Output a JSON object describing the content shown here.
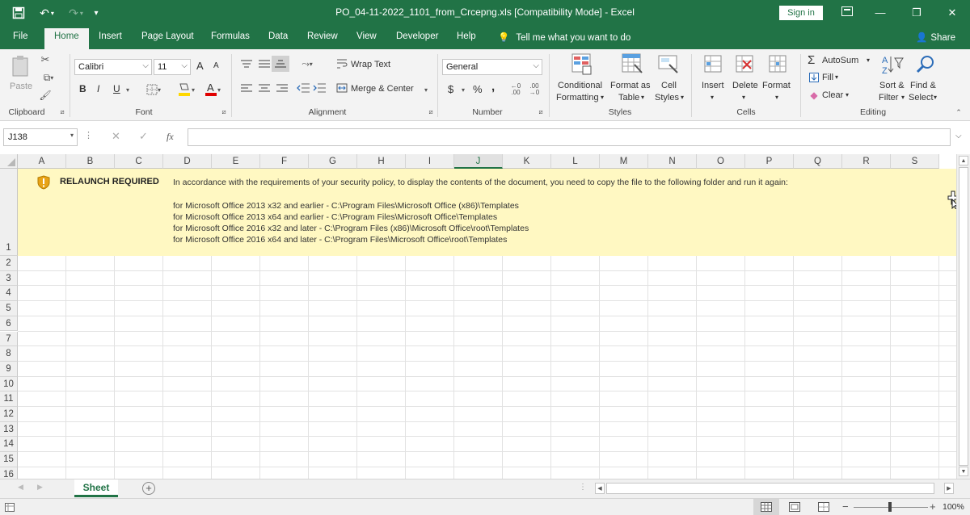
{
  "window": {
    "title": "PO_04-11-2022_1101_from_Crcepng.xls [Compatibility Mode] - Excel",
    "sign_in": "Sign in",
    "share": "Share",
    "tell_me": "Tell me what you want to do"
  },
  "tabs": [
    "File",
    "Home",
    "Insert",
    "Page Layout",
    "Formulas",
    "Data",
    "Review",
    "View",
    "Developer",
    "Help"
  ],
  "ribbon": {
    "clipboard": {
      "paste": "Paste",
      "label": "Clipboard"
    },
    "font": {
      "name": "Calibri",
      "size": "11",
      "label": "Font",
      "bold": "B",
      "italic": "I",
      "underline": "U",
      "grow": "A",
      "shrink": "A"
    },
    "alignment": {
      "wrap_text": "Wrap Text",
      "merge_center": "Merge & Center",
      "label": "Alignment"
    },
    "number": {
      "format": "General",
      "currency": "$",
      "percent": "%",
      "comma": ",",
      "label": "Number"
    },
    "styles": {
      "conditional_1": "Conditional",
      "conditional_2": "Formatting",
      "format_table_1": "Format as",
      "format_table_2": "Table",
      "cell_styles_1": "Cell",
      "cell_styles_2": "Styles",
      "label": "Styles"
    },
    "cells": {
      "insert": "Insert",
      "delete": "Delete",
      "format": "Format",
      "label": "Cells"
    },
    "editing": {
      "autosum": "AutoSum",
      "fill": "Fill",
      "clear": "Clear",
      "sort_1": "Sort &",
      "sort_2": "Filter",
      "find_1": "Find &",
      "find_2": "Select",
      "label": "Editing"
    }
  },
  "formula_bar": {
    "name_box": "J138",
    "fx": "fx",
    "value": ""
  },
  "columns": [
    "A",
    "B",
    "C",
    "D",
    "E",
    "F",
    "G",
    "H",
    "I",
    "J",
    "K",
    "L",
    "M",
    "N",
    "O",
    "P",
    "Q",
    "R",
    "S"
  ],
  "selected_column": "J",
  "rows": [
    "1",
    "2",
    "3",
    "4",
    "5",
    "6",
    "7",
    "8",
    "9",
    "10",
    "11",
    "12",
    "13",
    "14",
    "15",
    "16"
  ],
  "banner": {
    "heading": "RELAUNCH REQUIRED",
    "message": "In accordance with the requirements of your security policy, to display the contents of the document, you need to copy the file to the following folder and run it again:",
    "lines": [
      "for Microsoft Office 2013 x32 and earlier - C:\\Program Files\\Microsoft Office (x86)\\Templates",
      "for Microsoft Office 2013 x64 and earlier - C:\\Program Files\\Microsoft Office\\Templates",
      "for Microsoft Office 2016 x32 and later - C:\\Program Files (x86)\\Microsoft Office\\root\\Templates",
      "for Microsoft Office 2016 x64 and later - C:\\Program Files\\Microsoft Office\\root\\Templates"
    ]
  },
  "sheets": [
    "Sheet"
  ],
  "status": {
    "zoom": "100%"
  },
  "colors": {
    "accent": "#217346",
    "banner": "#fff8c2",
    "warning": "#e8a317"
  }
}
